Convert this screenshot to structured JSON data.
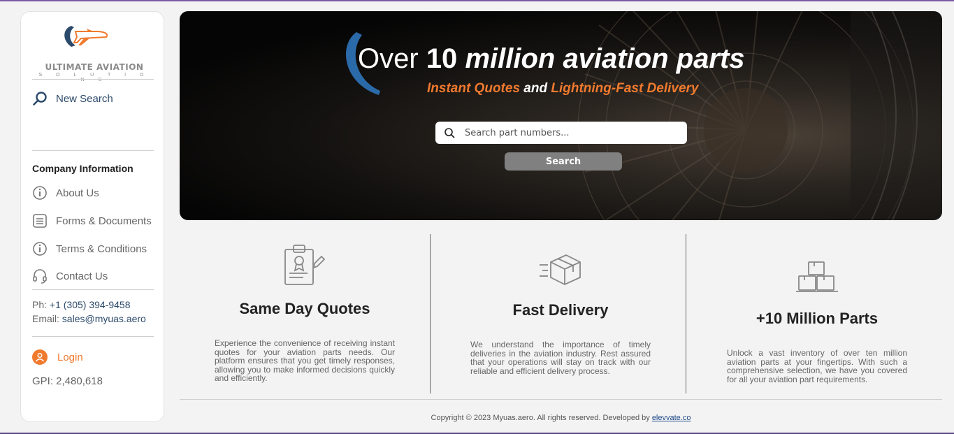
{
  "brand": {
    "name": "ULTIMATE AVIATION",
    "tagline": "S O L U T I O N S"
  },
  "sidebar": {
    "new_search": "New Search",
    "section_title": "Company Information",
    "items": [
      {
        "label": "About Us",
        "icon": "info-icon"
      },
      {
        "label": "Forms & Documents",
        "icon": "document-icon"
      },
      {
        "label": "Terms & Conditions",
        "icon": "info-icon"
      },
      {
        "label": "Contact Us",
        "icon": "headset-icon"
      }
    ],
    "phone_label": "Ph:",
    "phone": "+1 (305) 394-9458",
    "email_label": "Email:",
    "email": "sales@myuas.aero",
    "login": "Login",
    "gpi": "GPI: 2,480,618"
  },
  "hero": {
    "title_plain": "Over",
    "title_number": "10",
    "title_rest": "million aviation parts",
    "sub_a": "Instant Quotes",
    "sub_and": "and",
    "sub_b": "Lightning-Fast Delivery",
    "search_placeholder": "Search part numbers...",
    "search_button": "Search"
  },
  "features": [
    {
      "title": "Same Day Quotes",
      "text": "Experience the convenience of receiving instant quotes for your aviation parts needs. Our platform ensures that you get timely responses, allowing you to make informed decisions quickly and efficiently.",
      "icon": "clipboard-certificate-icon"
    },
    {
      "title": "Fast Delivery",
      "text": "We understand the importance of timely deliveries in the aviation industry. Rest assured that your operations will stay on track with our reliable and efficient delivery process.",
      "icon": "delivery-box-icon"
    },
    {
      "title": "+10 Million Parts",
      "text": "Unlock a vast inventory of over ten million aviation parts at your fingertips. With such a comprehensive selection, we have you covered for all your aviation part requirements.",
      "icon": "stacked-boxes-icon"
    }
  ],
  "footer": {
    "text": "Copyright © 2023 Myuas.aero. All rights reserved. Developed by",
    "link": "elevvate.co"
  },
  "colors": {
    "accent_orange": "#f07a2e",
    "brand_blue": "#2c4a6b",
    "button_gray": "#808080"
  }
}
